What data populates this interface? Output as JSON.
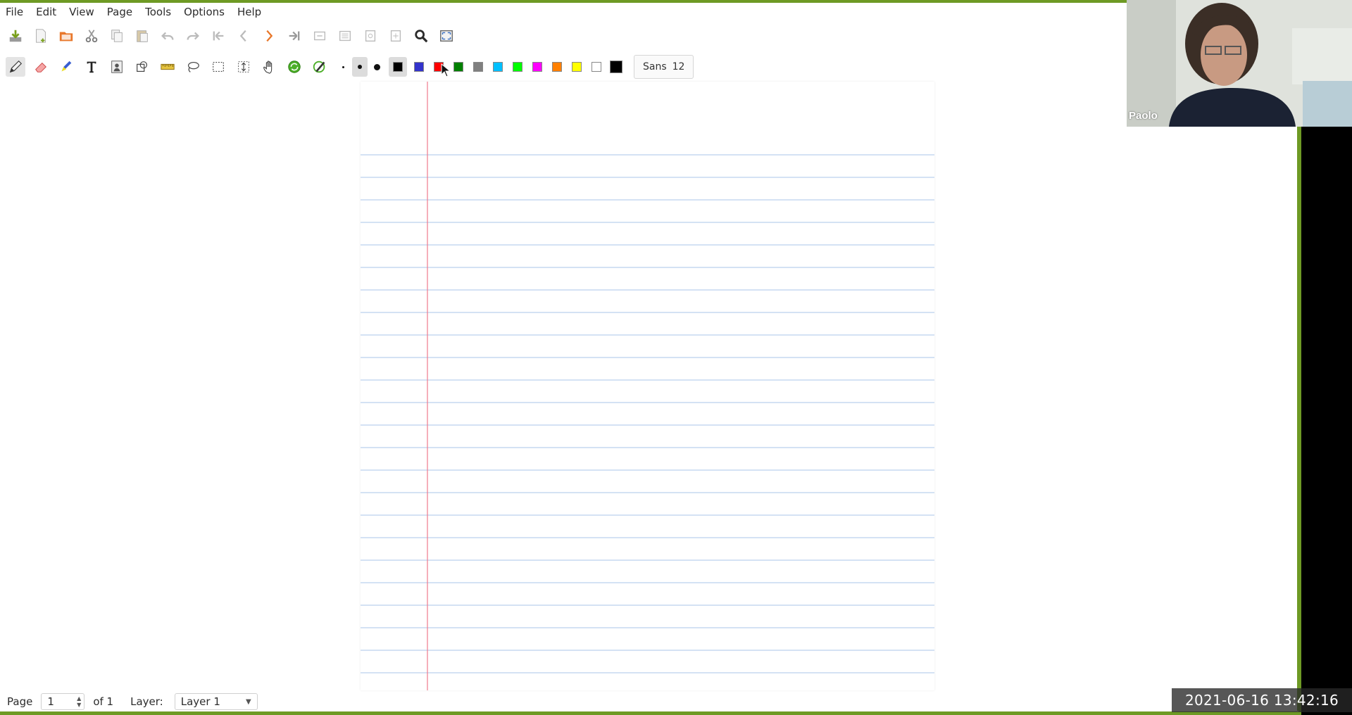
{
  "menubar": {
    "items": [
      {
        "label": "File"
      },
      {
        "label": "Edit"
      },
      {
        "label": "View"
      },
      {
        "label": "Page"
      },
      {
        "label": "Tools"
      },
      {
        "label": "Options"
      },
      {
        "label": "Help"
      }
    ]
  },
  "toolbar_main": {
    "icons": [
      "save-icon",
      "new-page-icon",
      "open-folder-icon",
      "cut-icon",
      "copy-icon",
      "paste-icon",
      "undo-icon",
      "redo-icon",
      "first-page-icon",
      "previous-page-icon",
      "next-page-icon",
      "last-page-icon",
      "zoom-out-icon",
      "zoom-fit-icon",
      "zoom-normal-icon",
      "zoom-in-icon",
      "search-icon",
      "fullscreen-icon"
    ]
  },
  "toolbar_tools": {
    "icons": [
      "pen-icon",
      "eraser-icon",
      "highlighter-icon",
      "text-icon",
      "image-icon",
      "shape-recognizer-icon",
      "ruler-icon",
      "lasso-select-icon",
      "rect-select-icon",
      "vertical-space-icon",
      "hand-icon",
      "default-tool-icon",
      "pen-settings-icon"
    ],
    "thickness": [
      "fine",
      "medium",
      "thick"
    ],
    "colors": [
      {
        "name": "black",
        "hex": "#000000"
      },
      {
        "name": "blue",
        "hex": "#3333cc"
      },
      {
        "name": "red",
        "hex": "#ff0000"
      },
      {
        "name": "green",
        "hex": "#008000"
      },
      {
        "name": "gray",
        "hex": "#808080"
      },
      {
        "name": "light-blue",
        "hex": "#00c0ff"
      },
      {
        "name": "light-green",
        "hex": "#00ff00"
      },
      {
        "name": "magenta",
        "hex": "#ff00ff"
      },
      {
        "name": "orange",
        "hex": "#ff8000"
      },
      {
        "name": "yellow",
        "hex": "#ffff00"
      },
      {
        "name": "white",
        "hex": "#ffffff"
      },
      {
        "name": "current",
        "hex": "#000000"
      }
    ],
    "font_name": "Sans",
    "font_size": "12"
  },
  "statusbar": {
    "page_label": "Page",
    "page_value": "1",
    "page_of": "of 1",
    "layer_label": "Layer:",
    "layer_value": "Layer 1"
  },
  "webcam": {
    "name": "Paolo"
  },
  "timestamp": "2021-06-16 13:42:16"
}
